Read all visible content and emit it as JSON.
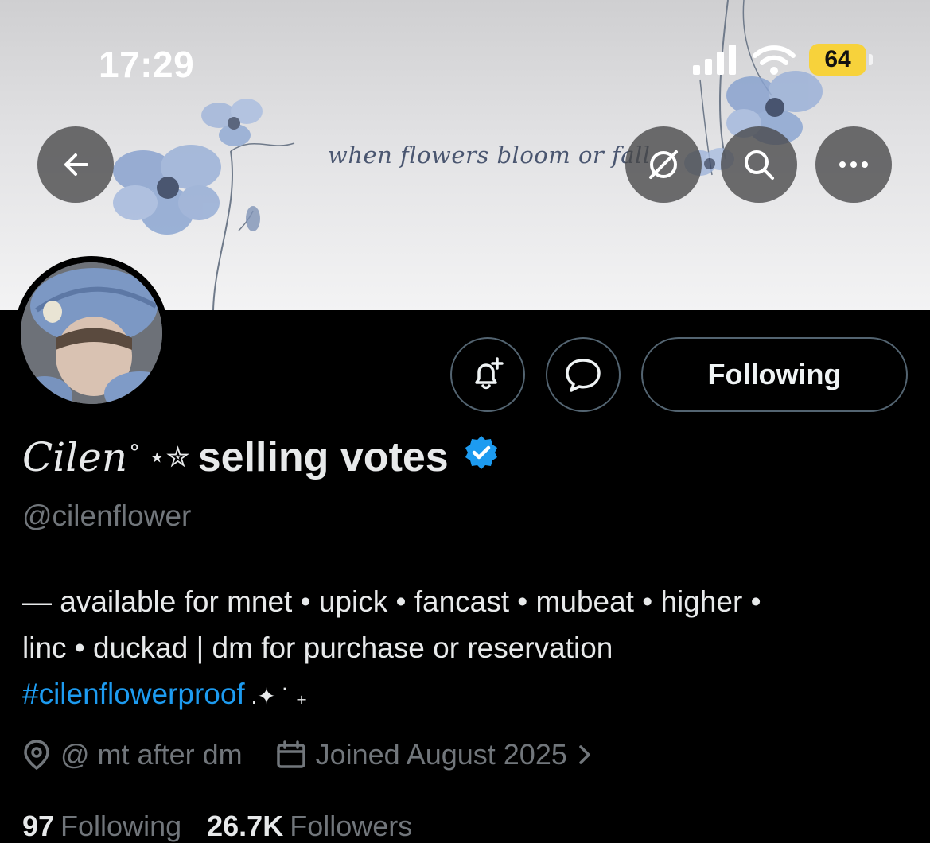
{
  "status_bar": {
    "time": "17:29",
    "battery": "64"
  },
  "banner": {
    "tagline": "when flowers bloom or fall"
  },
  "top_actions": [
    "back-icon",
    "grok-icon",
    "search-icon",
    "more-icon"
  ],
  "profile": {
    "name_deco": "Cilen",
    "name_stars": "˚ ⋆✮",
    "name_main": "selling votes",
    "handle": "@cilenflower",
    "bio_line1": "— available for mnet • upick • fancast • mubeat • higher •",
    "bio_line2": "linc • duckad | dm for purchase or reservation",
    "bio_hashtag": "#cilenflowerproof",
    "bio_suffix": " .✦ ˙ ₊",
    "location": "@ mt after dm",
    "joined": "Joined August 2025",
    "following_count": "97",
    "following_label": "Following",
    "followers_count": "26.7K",
    "followers_label": "Followers"
  },
  "buttons": {
    "following": "Following"
  },
  "colors": {
    "link": "#1d9bf0",
    "verified": "#1d9bf0",
    "battery": "#f7d23b",
    "muted": "#71767b"
  }
}
